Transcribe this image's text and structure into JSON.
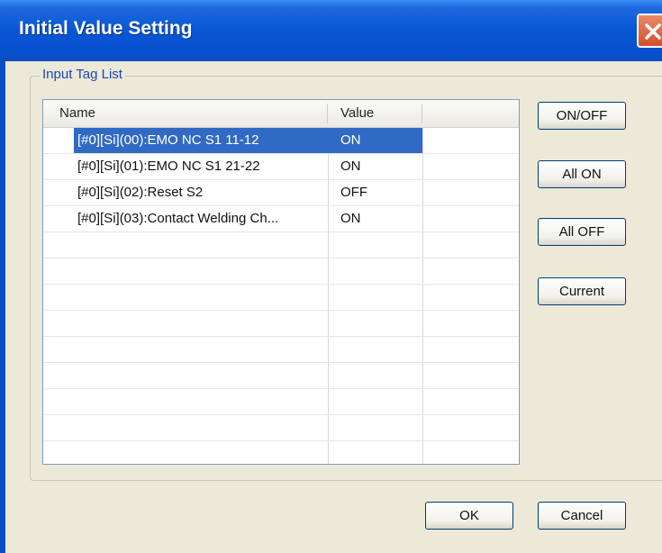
{
  "window": {
    "title": "Initial Value Setting"
  },
  "group": {
    "label": "Input Tag List"
  },
  "list": {
    "columns": [
      "Name",
      "Value"
    ],
    "rows": [
      {
        "name": "[#0][Si](00):EMO NC S1 11-12",
        "value": "ON",
        "selected": true
      },
      {
        "name": "[#0][Si](01):EMO NC S1 21-22",
        "value": "ON",
        "selected": false
      },
      {
        "name": "[#0][Si](02):Reset S2",
        "value": "OFF",
        "selected": false
      },
      {
        "name": "[#0][Si](03):Contact Welding Ch...",
        "value": "ON",
        "selected": false
      }
    ]
  },
  "buttons": {
    "on_off": "ON/OFF",
    "all_on": "All ON",
    "all_off": "All OFF",
    "current": "Current",
    "ok": "OK",
    "cancel": "Cancel"
  },
  "colors": {
    "titlebar": "#0a58d6",
    "selection": "#316ac5",
    "dialog_bg": "#ece9d8"
  }
}
